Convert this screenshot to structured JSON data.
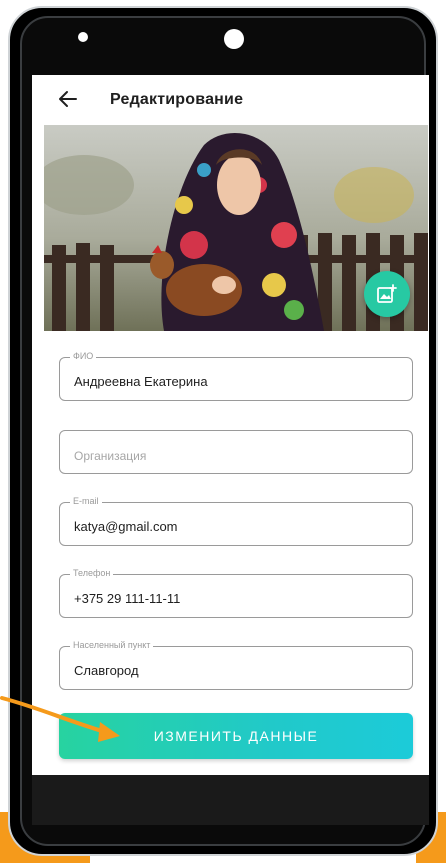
{
  "header": {
    "title": "Редактирование"
  },
  "icons": {
    "back": "arrow-left-icon",
    "change_photo": "add-photo-icon"
  },
  "form": {
    "fields": [
      {
        "label": "ФИО",
        "value": "Андреевна Екатерина",
        "placeholder": ""
      },
      {
        "label": "",
        "value": "",
        "placeholder": "Организация"
      },
      {
        "label": "E-mail",
        "value": "katya@gmail.com",
        "placeholder": ""
      },
      {
        "label": "Телефон",
        "value": "+375 29 111-11-11",
        "placeholder": ""
      },
      {
        "label": "Населенный пункт",
        "value": "Славгород",
        "placeholder": ""
      }
    ],
    "submit_label": "ИЗМЕНИТЬ ДАННЫЕ"
  },
  "colors": {
    "accent": "#27c9a3",
    "annotation_arrow": "#f59a1b"
  }
}
